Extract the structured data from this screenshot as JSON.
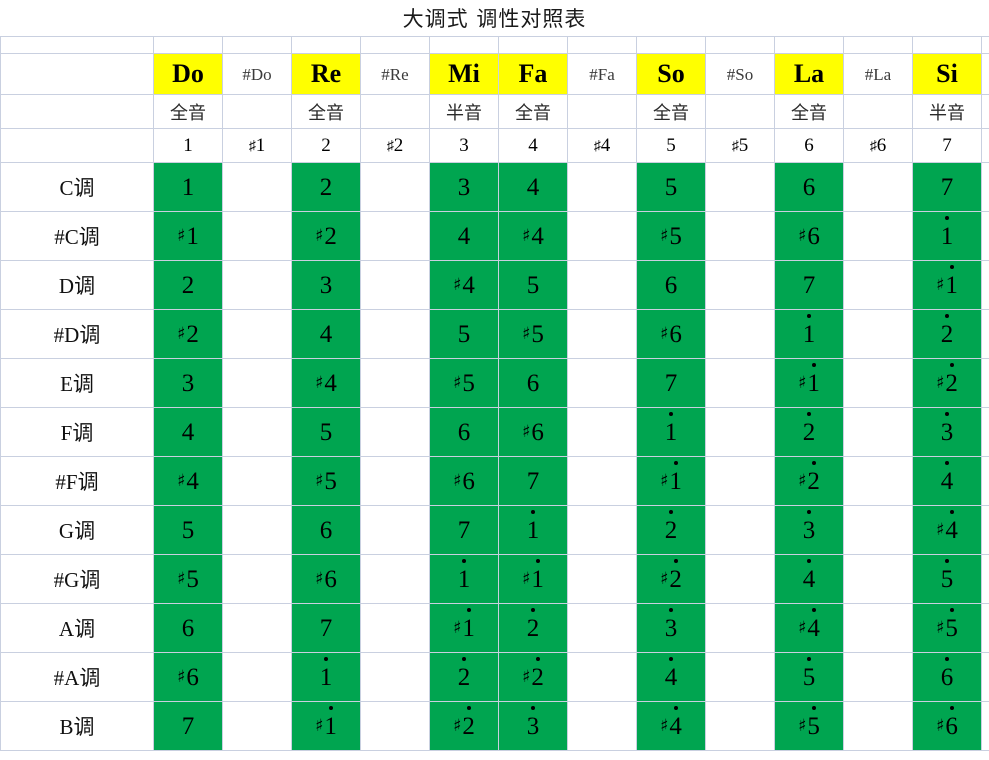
{
  "title": "大调式 调性对照表",
  "colors": {
    "highlight": "#ffff00",
    "accent": "#00a550",
    "grid": "#c9d0e0"
  },
  "header": {
    "notes": [
      {
        "label": "Do",
        "highlight": true,
        "small": false
      },
      {
        "label": "#Do",
        "highlight": false,
        "small": true
      },
      {
        "label": "Re",
        "highlight": true,
        "small": false
      },
      {
        "label": "#Re",
        "highlight": false,
        "small": true
      },
      {
        "label": "Mi",
        "highlight": true,
        "small": false
      },
      {
        "label": "Fa",
        "highlight": true,
        "small": false
      },
      {
        "label": "#Fa",
        "highlight": false,
        "small": true
      },
      {
        "label": "So",
        "highlight": true,
        "small": false
      },
      {
        "label": "#So",
        "highlight": false,
        "small": true
      },
      {
        "label": "La",
        "highlight": true,
        "small": false
      },
      {
        "label": "#La",
        "highlight": false,
        "small": true
      },
      {
        "label": "Si",
        "highlight": true,
        "small": false
      }
    ],
    "steps": [
      "全音",
      "",
      "全音",
      "",
      "半音",
      "全音",
      "",
      "全音",
      "",
      "全音",
      "",
      "半音"
    ],
    "degrees": [
      {
        "sharp": false,
        "num": "1"
      },
      {
        "sharp": true,
        "num": "1"
      },
      {
        "sharp": false,
        "num": "2"
      },
      {
        "sharp": true,
        "num": "2"
      },
      {
        "sharp": false,
        "num": "3"
      },
      {
        "sharp": false,
        "num": "4"
      },
      {
        "sharp": true,
        "num": "4"
      },
      {
        "sharp": false,
        "num": "5"
      },
      {
        "sharp": true,
        "num": "5"
      },
      {
        "sharp": false,
        "num": "6"
      },
      {
        "sharp": true,
        "num": "6"
      },
      {
        "sharp": false,
        "num": "7"
      }
    ]
  },
  "scale_columns_green": [
    true,
    false,
    true,
    false,
    true,
    true,
    false,
    true,
    false,
    true,
    false,
    true
  ],
  "rows": [
    {
      "key": "C调",
      "cells": [
        {
          "s": false,
          "n": "1",
          "d": false
        },
        null,
        {
          "s": false,
          "n": "2",
          "d": false
        },
        null,
        {
          "s": false,
          "n": "3",
          "d": false
        },
        {
          "s": false,
          "n": "4",
          "d": false
        },
        null,
        {
          "s": false,
          "n": "5",
          "d": false
        },
        null,
        {
          "s": false,
          "n": "6",
          "d": false
        },
        null,
        {
          "s": false,
          "n": "7",
          "d": false
        }
      ]
    },
    {
      "key": "#C调",
      "cells": [
        {
          "s": true,
          "n": "1",
          "d": false
        },
        null,
        {
          "s": true,
          "n": "2",
          "d": false
        },
        null,
        {
          "s": false,
          "n": "4",
          "d": false
        },
        {
          "s": true,
          "n": "4",
          "d": false
        },
        null,
        {
          "s": true,
          "n": "5",
          "d": false
        },
        null,
        {
          "s": true,
          "n": "6",
          "d": false
        },
        null,
        {
          "s": false,
          "n": "1",
          "d": true
        }
      ]
    },
    {
      "key": "D调",
      "cells": [
        {
          "s": false,
          "n": "2",
          "d": false
        },
        null,
        {
          "s": false,
          "n": "3",
          "d": false
        },
        null,
        {
          "s": true,
          "n": "4",
          "d": false
        },
        {
          "s": false,
          "n": "5",
          "d": false
        },
        null,
        {
          "s": false,
          "n": "6",
          "d": false
        },
        null,
        {
          "s": false,
          "n": "7",
          "d": false
        },
        null,
        {
          "s": true,
          "n": "1",
          "d": true
        }
      ]
    },
    {
      "key": "#D调",
      "cells": [
        {
          "s": true,
          "n": "2",
          "d": false
        },
        null,
        {
          "s": false,
          "n": "4",
          "d": false
        },
        null,
        {
          "s": false,
          "n": "5",
          "d": false
        },
        {
          "s": true,
          "n": "5",
          "d": false
        },
        null,
        {
          "s": true,
          "n": "6",
          "d": false
        },
        null,
        {
          "s": false,
          "n": "1",
          "d": true
        },
        null,
        {
          "s": false,
          "n": "2",
          "d": true
        }
      ]
    },
    {
      "key": "E调",
      "cells": [
        {
          "s": false,
          "n": "3",
          "d": false
        },
        null,
        {
          "s": true,
          "n": "4",
          "d": false
        },
        null,
        {
          "s": true,
          "n": "5",
          "d": false
        },
        {
          "s": false,
          "n": "6",
          "d": false
        },
        null,
        {
          "s": false,
          "n": "7",
          "d": false
        },
        null,
        {
          "s": true,
          "n": "1",
          "d": true
        },
        null,
        {
          "s": true,
          "n": "2",
          "d": true
        }
      ]
    },
    {
      "key": "F调",
      "cells": [
        {
          "s": false,
          "n": "4",
          "d": false
        },
        null,
        {
          "s": false,
          "n": "5",
          "d": false
        },
        null,
        {
          "s": false,
          "n": "6",
          "d": false
        },
        {
          "s": true,
          "n": "6",
          "d": false
        },
        null,
        {
          "s": false,
          "n": "1",
          "d": true
        },
        null,
        {
          "s": false,
          "n": "2",
          "d": true
        },
        null,
        {
          "s": false,
          "n": "3",
          "d": true
        }
      ]
    },
    {
      "key": "#F调",
      "cells": [
        {
          "s": true,
          "n": "4",
          "d": false
        },
        null,
        {
          "s": true,
          "n": "5",
          "d": false
        },
        null,
        {
          "s": true,
          "n": "6",
          "d": false
        },
        {
          "s": false,
          "n": "7",
          "d": false
        },
        null,
        {
          "s": true,
          "n": "1",
          "d": true
        },
        null,
        {
          "s": true,
          "n": "2",
          "d": true
        },
        null,
        {
          "s": false,
          "n": "4",
          "d": true
        }
      ]
    },
    {
      "key": "G调",
      "cells": [
        {
          "s": false,
          "n": "5",
          "d": false
        },
        null,
        {
          "s": false,
          "n": "6",
          "d": false
        },
        null,
        {
          "s": false,
          "n": "7",
          "d": false
        },
        {
          "s": false,
          "n": "1",
          "d": true
        },
        null,
        {
          "s": false,
          "n": "2",
          "d": true
        },
        null,
        {
          "s": false,
          "n": "3",
          "d": true
        },
        null,
        {
          "s": true,
          "n": "4",
          "d": true
        }
      ]
    },
    {
      "key": "#G调",
      "cells": [
        {
          "s": true,
          "n": "5",
          "d": false
        },
        null,
        {
          "s": true,
          "n": "6",
          "d": false
        },
        null,
        {
          "s": false,
          "n": "1",
          "d": true
        },
        {
          "s": true,
          "n": "1",
          "d": true
        },
        null,
        {
          "s": true,
          "n": "2",
          "d": true
        },
        null,
        {
          "s": false,
          "n": "4",
          "d": true
        },
        null,
        {
          "s": false,
          "n": "5",
          "d": true
        }
      ]
    },
    {
      "key": "A调",
      "cells": [
        {
          "s": false,
          "n": "6",
          "d": false
        },
        null,
        {
          "s": false,
          "n": "7",
          "d": false
        },
        null,
        {
          "s": true,
          "n": "1",
          "d": true
        },
        {
          "s": false,
          "n": "2",
          "d": true
        },
        null,
        {
          "s": false,
          "n": "3",
          "d": true
        },
        null,
        {
          "s": true,
          "n": "4",
          "d": true
        },
        null,
        {
          "s": true,
          "n": "5",
          "d": true
        }
      ]
    },
    {
      "key": "#A调",
      "cells": [
        {
          "s": true,
          "n": "6",
          "d": false
        },
        null,
        {
          "s": false,
          "n": "1",
          "d": true
        },
        null,
        {
          "s": false,
          "n": "2",
          "d": true
        },
        {
          "s": true,
          "n": "2",
          "d": true
        },
        null,
        {
          "s": false,
          "n": "4",
          "d": true
        },
        null,
        {
          "s": false,
          "n": "5",
          "d": true
        },
        null,
        {
          "s": false,
          "n": "6",
          "d": true
        }
      ]
    },
    {
      "key": "B调",
      "cells": [
        {
          "s": false,
          "n": "7",
          "d": false
        },
        null,
        {
          "s": true,
          "n": "1",
          "d": true
        },
        null,
        {
          "s": true,
          "n": "2",
          "d": true
        },
        {
          "s": false,
          "n": "3",
          "d": true
        },
        null,
        {
          "s": true,
          "n": "4",
          "d": true
        },
        null,
        {
          "s": true,
          "n": "5",
          "d": true
        },
        null,
        {
          "s": true,
          "n": "6",
          "d": true
        }
      ]
    }
  ]
}
